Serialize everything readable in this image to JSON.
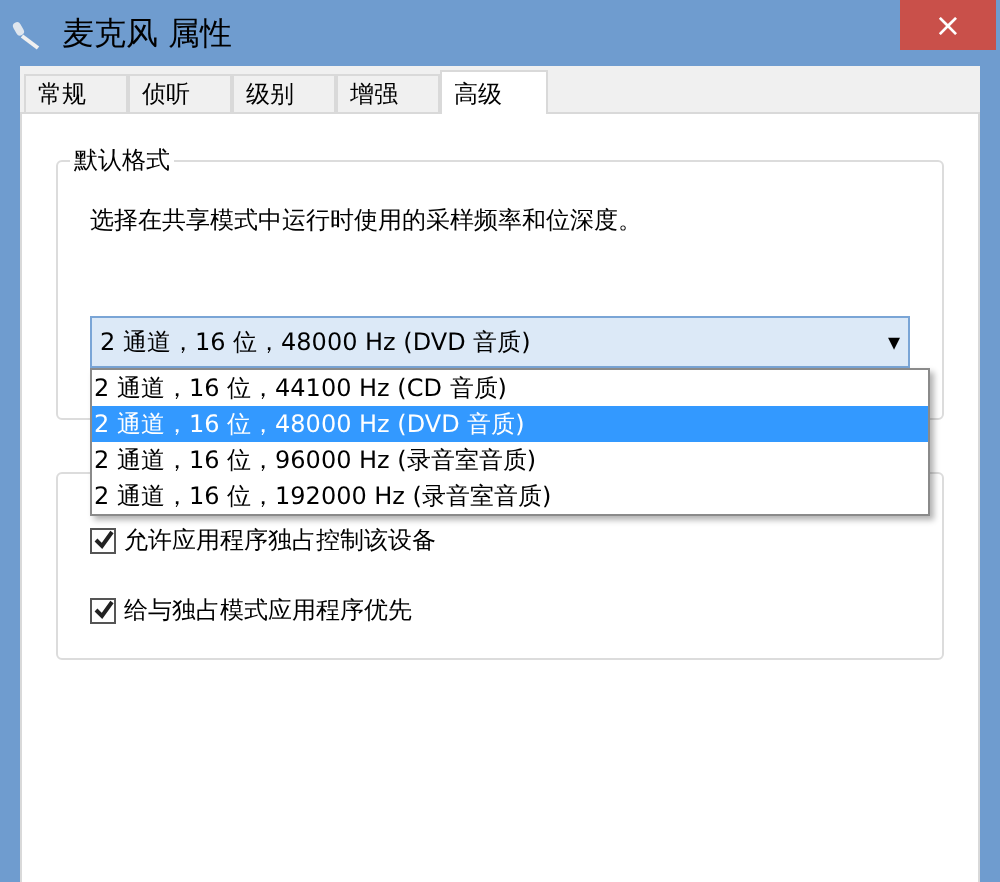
{
  "window": {
    "title": "麦克风 属性",
    "close": "×"
  },
  "tabs": [
    {
      "label": "常规",
      "selected": false
    },
    {
      "label": "侦听",
      "selected": false
    },
    {
      "label": "级别",
      "selected": false
    },
    {
      "label": "增强",
      "selected": false
    },
    {
      "label": "高级",
      "selected": true
    }
  ],
  "default_format": {
    "title": "默认格式",
    "description": "选择在共享模式中运行时使用的采样频率和位深度。",
    "dropdown": {
      "value": "2 通道，16 位，48000 Hz (DVD 音质)",
      "arrow": "▾",
      "options": [
        {
          "label": "2 通道，16 位，44100 Hz (CD 音质)",
          "selected": false
        },
        {
          "label": "2 通道，16 位，48000 Hz (DVD 音质)",
          "selected": true
        },
        {
          "label": "2 通道，16 位，96000 Hz (录音室音质)",
          "selected": false
        },
        {
          "label": "2 通道，16 位，192000 Hz (录音室音质)",
          "selected": false
        }
      ]
    }
  },
  "exclusive_mode": {
    "checkboxes": [
      {
        "label": "允许应用程序独占控制该设备",
        "checked": true
      },
      {
        "label": "给与独占模式应用程序优先",
        "checked": true
      }
    ]
  }
}
